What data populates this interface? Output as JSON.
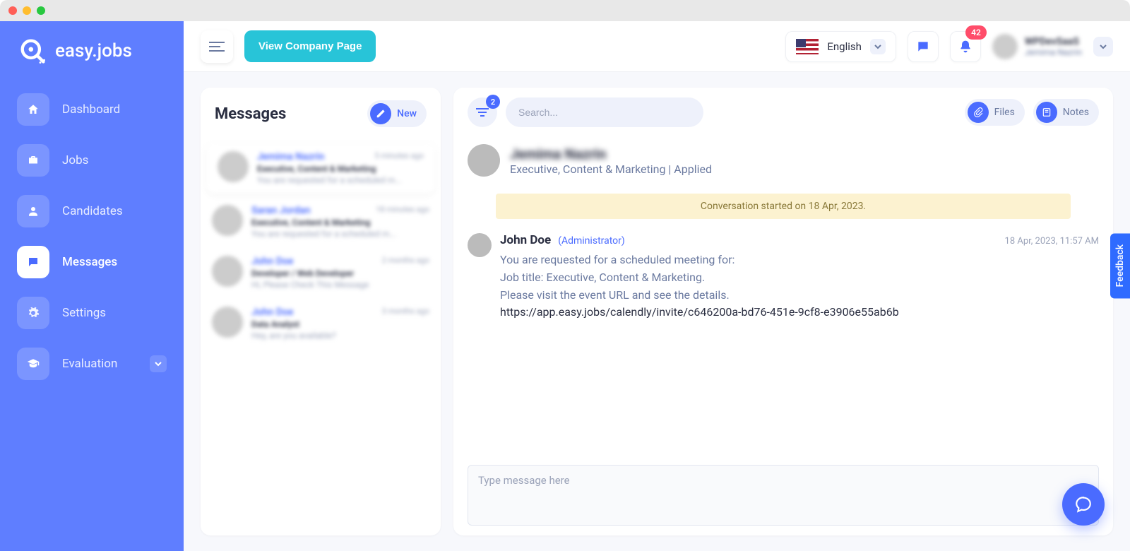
{
  "brand": {
    "name": "easy.jobs"
  },
  "sidebar": {
    "items": [
      {
        "label": "Dashboard",
        "icon": "home"
      },
      {
        "label": "Jobs",
        "icon": "briefcase"
      },
      {
        "label": "Candidates",
        "icon": "user"
      },
      {
        "label": "Messages",
        "icon": "chat",
        "active": true
      },
      {
        "label": "Settings",
        "icon": "gear"
      },
      {
        "label": "Evaluation",
        "icon": "grad-cap",
        "chevron": true
      }
    ]
  },
  "topbar": {
    "view_company_label": "View Company Page",
    "language": {
      "label": "English"
    },
    "notifications": {
      "count": "42"
    },
    "user": {
      "company": "WPDevSaaS",
      "name": "Jemima Nazrin"
    }
  },
  "messages": {
    "title": "Messages",
    "new_label": "New",
    "threads": [
      {
        "name": "Jemima Nazrin",
        "time": "5 minutes ago",
        "subtitle": "Executive, Content & Marketing",
        "preview": "You are requested for a scheduled m...",
        "selected": true
      },
      {
        "name": "Saran Jordan",
        "time": "18 minutes ago",
        "subtitle": "Executive, Content & Marketing",
        "preview": "You are requested for a scheduled m..."
      },
      {
        "name": "John Doe",
        "time": "2 months ago",
        "subtitle": "Developer / Web Developer",
        "preview": "Hi, Please Check This Message"
      },
      {
        "name": "John Doe",
        "time": "3 months ago",
        "subtitle": "Data Analyst",
        "preview": "Hey, are you available?"
      }
    ]
  },
  "conversation": {
    "filter_badge": "2",
    "search_placeholder": "Search...",
    "files_label": "Files",
    "notes_label": "Notes",
    "header": {
      "name": "Jemima Nazrin",
      "subtitle": "Executive, Content & Marketing | Applied"
    },
    "banner": "Conversation started on 18 Apr, 2023.",
    "message": {
      "author": "John Doe",
      "role": "(Administrator)",
      "timestamp": "18 Apr, 2023, 11:57 AM",
      "line1": "You are requested for a scheduled meeting for:",
      "line2": "Job title: Executive, Content & Marketing.",
      "line3": "Please visit the event URL and see the details.",
      "link": "https://app.easy.jobs/calendly/invite/c646200a-bd76-451e-9cf8-e3906e55ab6b"
    },
    "compose_placeholder": "Type message here"
  },
  "feedback_tab": "Feedback"
}
